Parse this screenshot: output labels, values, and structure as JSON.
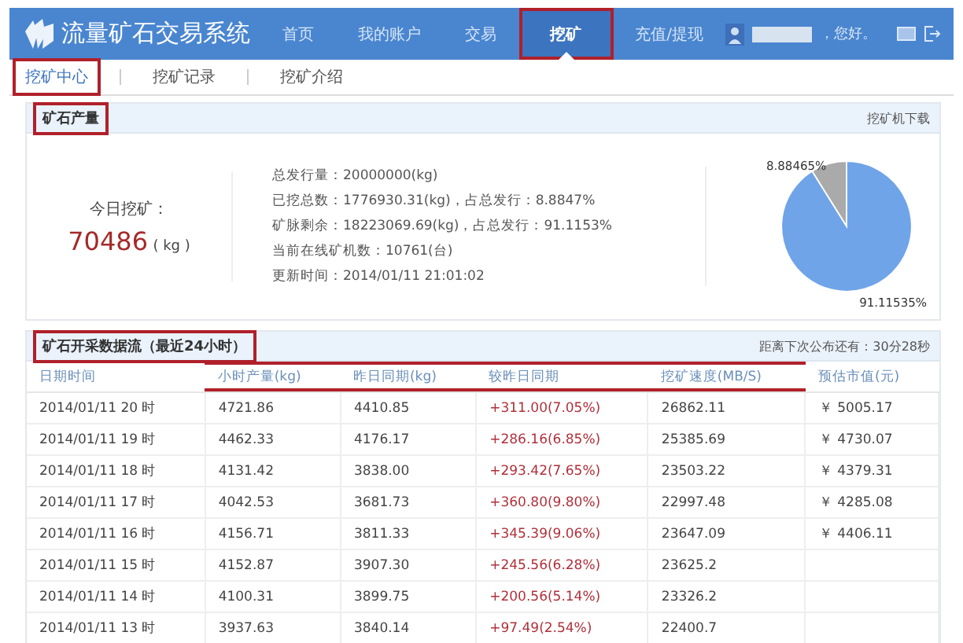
{
  "header": {
    "logo": "流量矿石交易系统",
    "nav": [
      {
        "label": "首页",
        "selected": false,
        "annotated": false
      },
      {
        "label": "我的账户",
        "selected": false,
        "annotated": false
      },
      {
        "label": "交易",
        "selected": false,
        "annotated": false
      },
      {
        "label": "挖矿",
        "selected": true,
        "annotated": true
      },
      {
        "label": "充值/提现",
        "selected": false,
        "annotated": false
      }
    ],
    "greeting": "，您好。"
  },
  "subnav": [
    {
      "label": "挖矿中心",
      "selected": true,
      "annotated": true
    },
    {
      "label": "挖矿记录",
      "selected": false,
      "annotated": false
    },
    {
      "label": "挖矿介绍",
      "selected": false,
      "annotated": false
    }
  ],
  "output_panel": {
    "title": "矿石产量",
    "title_annotated": true,
    "link": "挖矿机下载",
    "today_label": "今日挖矿：",
    "today_value": "70486",
    "today_unit": "( kg )",
    "stats": [
      "总发行量：20000000(kg)",
      "已挖总数：1776930.31(kg)，占总发行：8.8847%",
      "矿脉剩余：18223069.69(kg)，占总发行：91.1153%",
      "当前在线矿机数：10761(台)",
      "更新时间：2014/01/11 21:01:02"
    ],
    "chart_data": {
      "type": "pie",
      "values": [
        8.88465,
        91.11535
      ],
      "colors": [
        "#aaaaaa",
        "#6fa4e8"
      ],
      "value_labels": [
        "8.88465%",
        "91.11535%"
      ]
    }
  },
  "data_panel": {
    "title": "矿石开采数据流（最近24小时）",
    "title_annotated": true,
    "countdown": "距离下次公布还有：30分28秒",
    "columns": [
      {
        "label": "日期时间",
        "annotated": false
      },
      {
        "label": "小时产量(kg)",
        "annotated": true
      },
      {
        "label": "昨日同期(kg)",
        "annotated": true
      },
      {
        "label": "较昨日同期",
        "annotated": true
      },
      {
        "label": "挖矿速度(MB/S)",
        "annotated": true
      },
      {
        "label": "预估市值(元)",
        "annotated": false
      }
    ],
    "rows": [
      [
        "2014/01/11 20 时",
        "4721.86",
        "4410.85",
        "+311.00(7.05%)",
        "26862.11",
        "￥ 5005.17"
      ],
      [
        "2014/01/11 19 时",
        "4462.33",
        "4176.17",
        "+286.16(6.85%)",
        "25385.69",
        "￥ 4730.07"
      ],
      [
        "2014/01/11 18 时",
        "4131.42",
        "3838.00",
        "+293.42(7.65%)",
        "23503.22",
        "￥ 4379.31"
      ],
      [
        "2014/01/11 17 时",
        "4042.53",
        "3681.73",
        "+360.80(9.80%)",
        "22997.48",
        "￥ 4285.08"
      ],
      [
        "2014/01/11 16 时",
        "4156.71",
        "3811.33",
        "+345.39(9.06%)",
        "23647.09",
        "￥ 4406.11"
      ],
      [
        "2014/01/11 15 时",
        "4152.87",
        "3907.30",
        "+245.56(6.28%)",
        "23625.2"
      ],
      [
        "2014/01/11 14 时",
        "4100.31",
        "3899.75",
        "+200.56(5.14%)",
        "23326.2"
      ],
      [
        "2014/01/11 13 时",
        "3937.63",
        "3840.14",
        "+97.49(2.54%)",
        "22400.7"
      ]
    ]
  }
}
